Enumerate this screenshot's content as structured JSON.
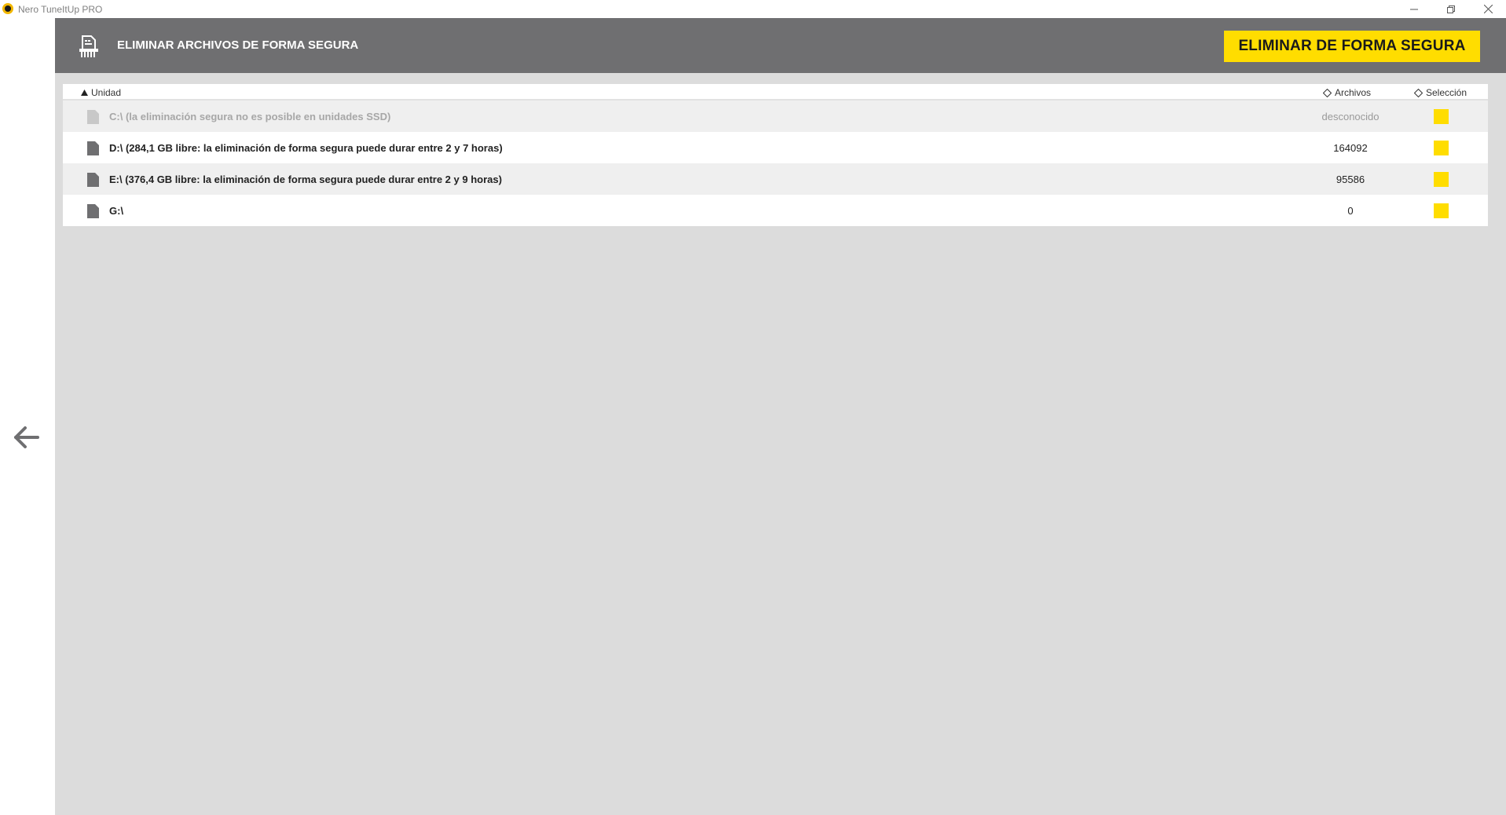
{
  "window": {
    "title": "Nero TuneItUp PRO"
  },
  "header": {
    "title": "ELIMINAR ARCHIVOS DE FORMA SEGURA",
    "primary_button": "ELIMINAR DE FORMA SEGURA"
  },
  "table": {
    "columns": {
      "unit": "Unidad",
      "files": "Archivos",
      "selection": "Selección"
    },
    "rows": [
      {
        "label": "C:\\ (la eliminación segura no es posible en unidades SSD)",
        "count": "desconocido",
        "disabled": true
      },
      {
        "label": "D:\\ (284,1 GB libre: la eliminación de forma segura puede durar entre 2 y 7 horas)",
        "count": "164092",
        "disabled": false
      },
      {
        "label": "E:\\ (376,4 GB libre: la eliminación de forma segura puede durar entre 2 y 9 horas)",
        "count": "95586",
        "disabled": false
      },
      {
        "label": "G:\\",
        "count": "0",
        "disabled": false
      }
    ]
  },
  "colors": {
    "accent": "#ffdd00",
    "header_bg": "#6f6f71",
    "content_bg": "#dcdcdc",
    "row_alt": "#efefef",
    "disabled_text": "#a7a7a7"
  },
  "icons": {
    "app_logo": "nero-logo-icon",
    "header": "shredder-icon",
    "back": "arrow-left-icon",
    "drive": "document-icon",
    "sort_asc": "triangle-up-icon",
    "sort_none": "diamond-icon"
  }
}
